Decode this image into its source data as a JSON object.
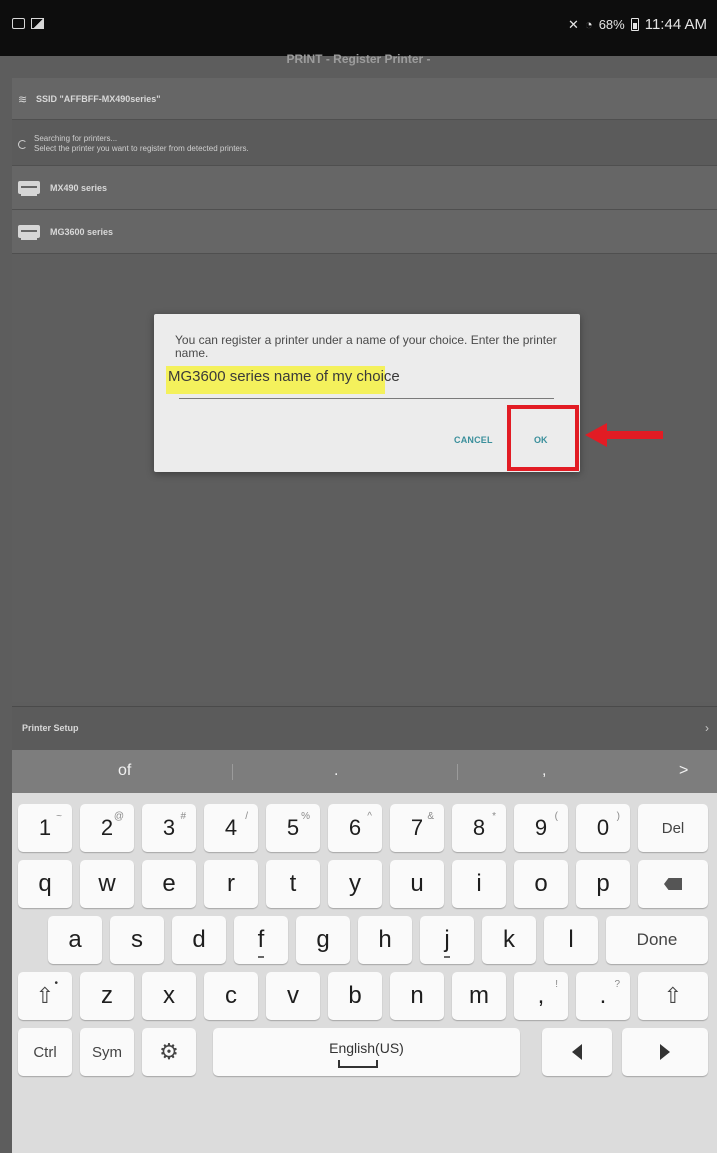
{
  "status_bar": {
    "battery": "68%",
    "time": "11:44 AM"
  },
  "app_title": "PRINT  - Register Printer -",
  "list": {
    "ssid": "SSID \"AFFBFF-MX490series\"",
    "searching_line1": "Searching for printers...",
    "searching_line2": "Select the printer you want to register from detected printers.",
    "printers": [
      "MX490 series",
      "MG3600 series"
    ]
  },
  "dialog": {
    "message": "You can register a printer under a name of your choice. Enter the printer name.",
    "input_value": "MG3600 series name of my choice",
    "cancel_label": "CANCEL",
    "ok_label": "OK",
    "highlight_color": "#f4f15c",
    "annotation_color": "#e21c24"
  },
  "setup_bar": {
    "label": "Printer Setup",
    "chevron": "›"
  },
  "keyboard": {
    "suggestions": [
      "of",
      ".",
      ","
    ],
    "suggest_arrow": ">",
    "number_row": [
      {
        "main": "1",
        "sup": "~"
      },
      {
        "main": "2",
        "sup": "@"
      },
      {
        "main": "3",
        "sup": "#"
      },
      {
        "main": "4",
        "sup": "/"
      },
      {
        "main": "5",
        "sup": "%"
      },
      {
        "main": "6",
        "sup": "^"
      },
      {
        "main": "7",
        "sup": "&"
      },
      {
        "main": "8",
        "sup": "*"
      },
      {
        "main": "9",
        "sup": "("
      },
      {
        "main": "0",
        "sup": ")"
      }
    ],
    "del_label": "Del",
    "row_q": [
      "q",
      "w",
      "e",
      "r",
      "t",
      "y",
      "u",
      "i",
      "o",
      "p"
    ],
    "row_a": [
      "a",
      "s",
      "d",
      "f",
      "g",
      "h",
      "j",
      "k",
      "l"
    ],
    "done_label": "Done",
    "row_z": [
      "z",
      "x",
      "c",
      "v",
      "b",
      "n",
      "m"
    ],
    "comma_key": {
      "main": ",",
      "sup": "!"
    },
    "period_key": {
      "main": ".",
      "sup": "?"
    },
    "ctrl_label": "Ctrl",
    "sym_label": "Sym",
    "space_label": "English(US)"
  }
}
